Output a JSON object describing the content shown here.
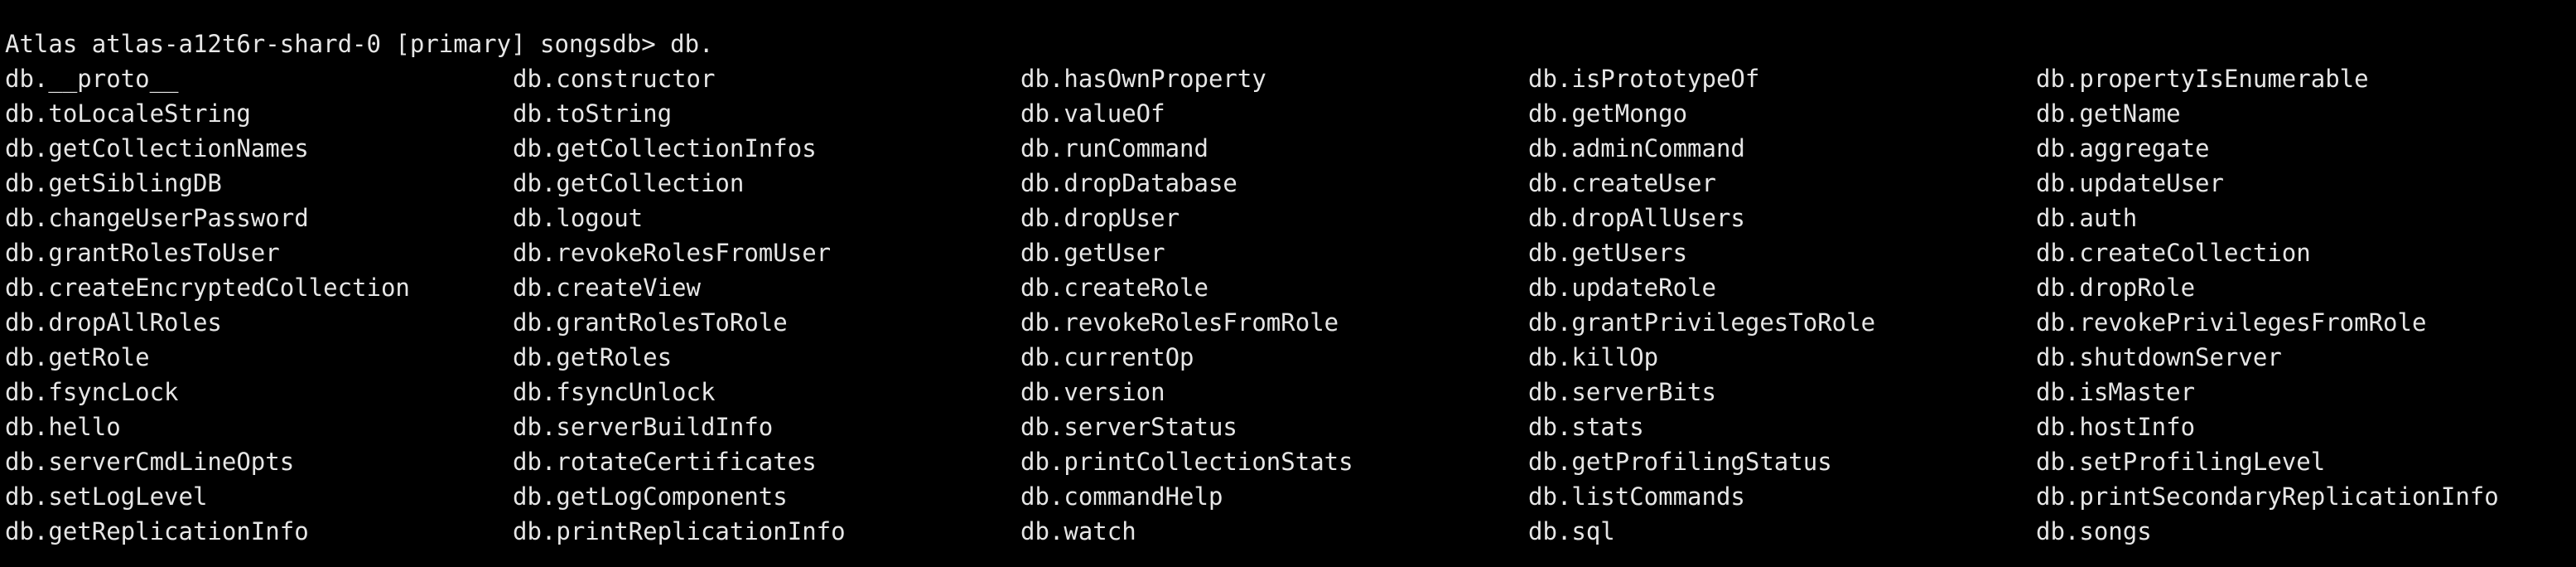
{
  "terminal": {
    "background": "#000000",
    "foreground": "#e6e6e6",
    "prompt": "Atlas atlas-a12t6r-shard-0 [primary] songsdb> db.",
    "completions": [
      "db.__proto__",
      "db.constructor",
      "db.hasOwnProperty",
      "db.isPrototypeOf",
      "db.propertyIsEnumerable",
      "db.toLocaleString",
      "db.toString",
      "db.valueOf",
      "db.getMongo",
      "db.getName",
      "db.getCollectionNames",
      "db.getCollectionInfos",
      "db.runCommand",
      "db.adminCommand",
      "db.aggregate",
      "db.getSiblingDB",
      "db.getCollection",
      "db.dropDatabase",
      "db.createUser",
      "db.updateUser",
      "db.changeUserPassword",
      "db.logout",
      "db.dropUser",
      "db.dropAllUsers",
      "db.auth",
      "db.grantRolesToUser",
      "db.revokeRolesFromUser",
      "db.getUser",
      "db.getUsers",
      "db.createCollection",
      "db.createEncryptedCollection",
      "db.createView",
      "db.createRole",
      "db.updateRole",
      "db.dropRole",
      "db.dropAllRoles",
      "db.grantRolesToRole",
      "db.revokeRolesFromRole",
      "db.grantPrivilegesToRole",
      "db.revokePrivilegesFromRole",
      "db.getRole",
      "db.getRoles",
      "db.currentOp",
      "db.killOp",
      "db.shutdownServer",
      "db.fsyncLock",
      "db.fsyncUnlock",
      "db.version",
      "db.serverBits",
      "db.isMaster",
      "db.hello",
      "db.serverBuildInfo",
      "db.serverStatus",
      "db.stats",
      "db.hostInfo",
      "db.serverCmdLineOpts",
      "db.rotateCertificates",
      "db.printCollectionStats",
      "db.getProfilingStatus",
      "db.setProfilingLevel",
      "db.setLogLevel",
      "db.getLogComponents",
      "db.commandHelp",
      "db.listCommands",
      "db.printSecondaryReplicationInfo",
      "db.getReplicationInfo",
      "db.printReplicationInfo",
      "db.watch",
      "db.sql",
      "db.songs"
    ]
  }
}
